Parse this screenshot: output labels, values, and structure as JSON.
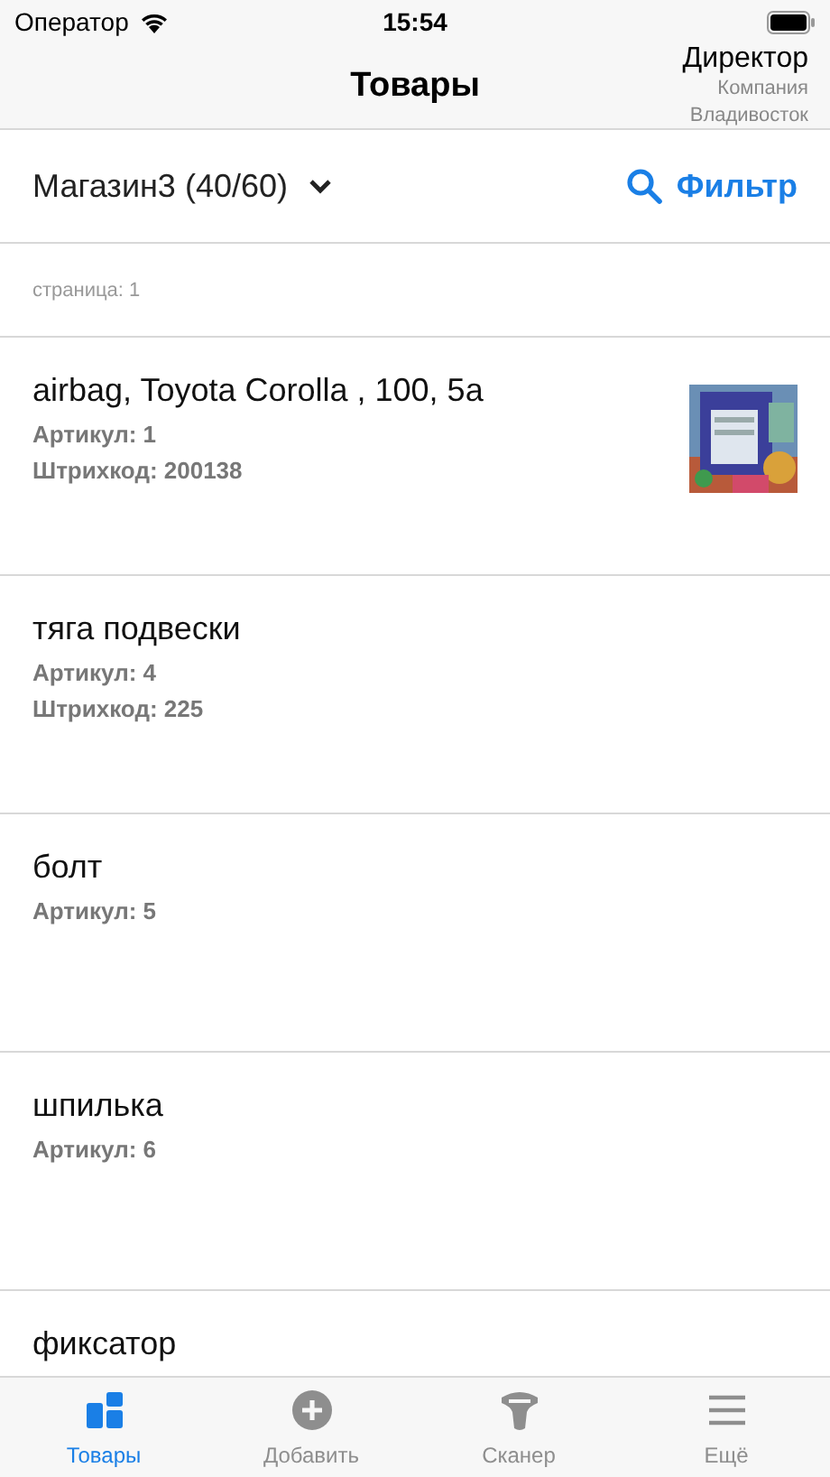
{
  "status_bar": {
    "carrier": "Оператор",
    "time": "15:54"
  },
  "nav": {
    "title": "Товары",
    "user": {
      "role": "Директор",
      "company": "Компания",
      "city": "Владивосток"
    }
  },
  "store_selector": {
    "label": "Магазин3 (40/60)",
    "filter": "Фильтр"
  },
  "page_label": "страница: 1",
  "products": [
    {
      "name": "airbag, Toyota Corolla , 100, 5a",
      "details": [
        "Артикул: 1",
        "Штрихкод: 200138"
      ]
    },
    {
      "name": "тяга подвески",
      "details": [
        "Артикул: 4",
        "Штрихкод: 225"
      ]
    },
    {
      "name": "болт",
      "details": [
        "Артикул: 5"
      ]
    },
    {
      "name": "шпилька",
      "details": [
        "Артикул: 6"
      ]
    },
    {
      "name": "фиксатор"
    }
  ],
  "tabs": [
    {
      "label": "Товары",
      "selected": true
    },
    {
      "label": "Добавить",
      "selected": false
    },
    {
      "label": "Сканер",
      "selected": false
    },
    {
      "label": "Ещё",
      "selected": false
    }
  ]
}
